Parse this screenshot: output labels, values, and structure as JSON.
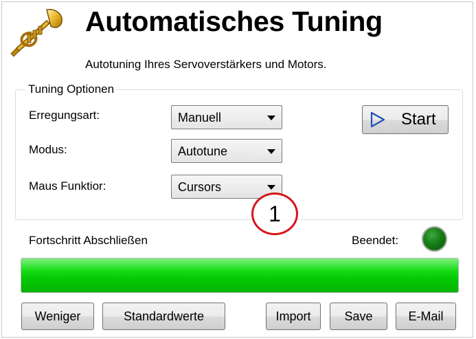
{
  "header": {
    "title": "Automatisches Tuning",
    "subtitle": "Autotuning Ihres Servoverstärkers und Motors.",
    "icon": "trumpet-icon"
  },
  "tuning_options": {
    "legend": "Tuning Optionen",
    "excitation": {
      "label": "Erregungsart:",
      "value": "Manuell"
    },
    "mode": {
      "label": "Modus:",
      "value": "Autotune"
    },
    "mouse_function": {
      "label": "Maus Funktior:",
      "value": "Cursors"
    },
    "start_button": {
      "label": "Start",
      "icon": "play-icon"
    }
  },
  "callout": {
    "number": "1",
    "color": "#d7141a"
  },
  "progress": {
    "label": "Fortschritt Abschließen",
    "done_label": "Beendet:",
    "fraction": 1.0,
    "color": "#04c804",
    "led_color": "#137a13"
  },
  "buttons": {
    "less": "Weniger",
    "defaults": "Standardwerte",
    "import": "Import",
    "save": "Save",
    "email": "E-Mail"
  }
}
